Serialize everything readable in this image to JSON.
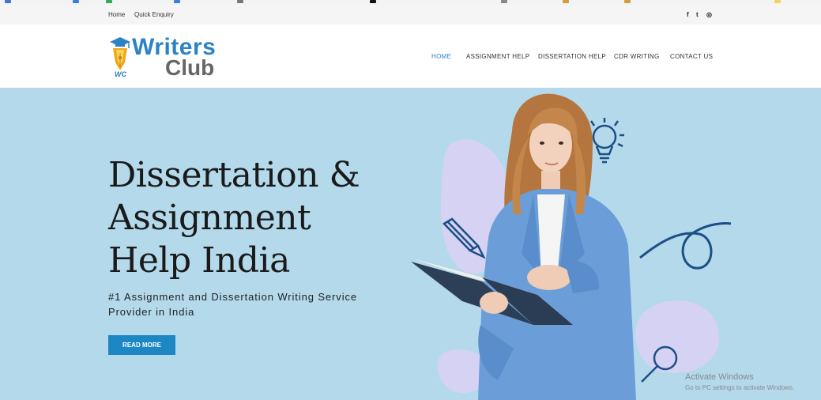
{
  "topbar": {
    "links": [
      "Home",
      "Quick Enquiry"
    ],
    "social_icons": [
      "facebook-icon",
      "twitter-icon",
      "instagram-icon"
    ],
    "social_glyphs": [
      "f",
      "t",
      "◎"
    ]
  },
  "header": {
    "logo": {
      "word1": "Writers",
      "word2": "Club",
      "monogram": "WC"
    },
    "nav": [
      "HOME",
      "ASSIGNMENT HELP",
      "DISSERTATION HELP",
      "CDR WRITING",
      "CONTACT US"
    ],
    "active_nav": "HOME"
  },
  "hero": {
    "headline": [
      "Dissertation &",
      "Assignment",
      "Help India"
    ],
    "subtitle": "#1 Assignment and Dissertation Writing Service Provider in India",
    "cta": "READ MORE"
  },
  "watermark": {
    "title": "Activate Windows",
    "subtitle": "Go to PC settings to activate Windows."
  },
  "colors": {
    "brand_blue": "#2d82c4",
    "hero_bg": "#b3d9ea",
    "button": "#1d87c4",
    "logo_gray": "#666666",
    "blob_lavender": "#d4d0f2"
  }
}
